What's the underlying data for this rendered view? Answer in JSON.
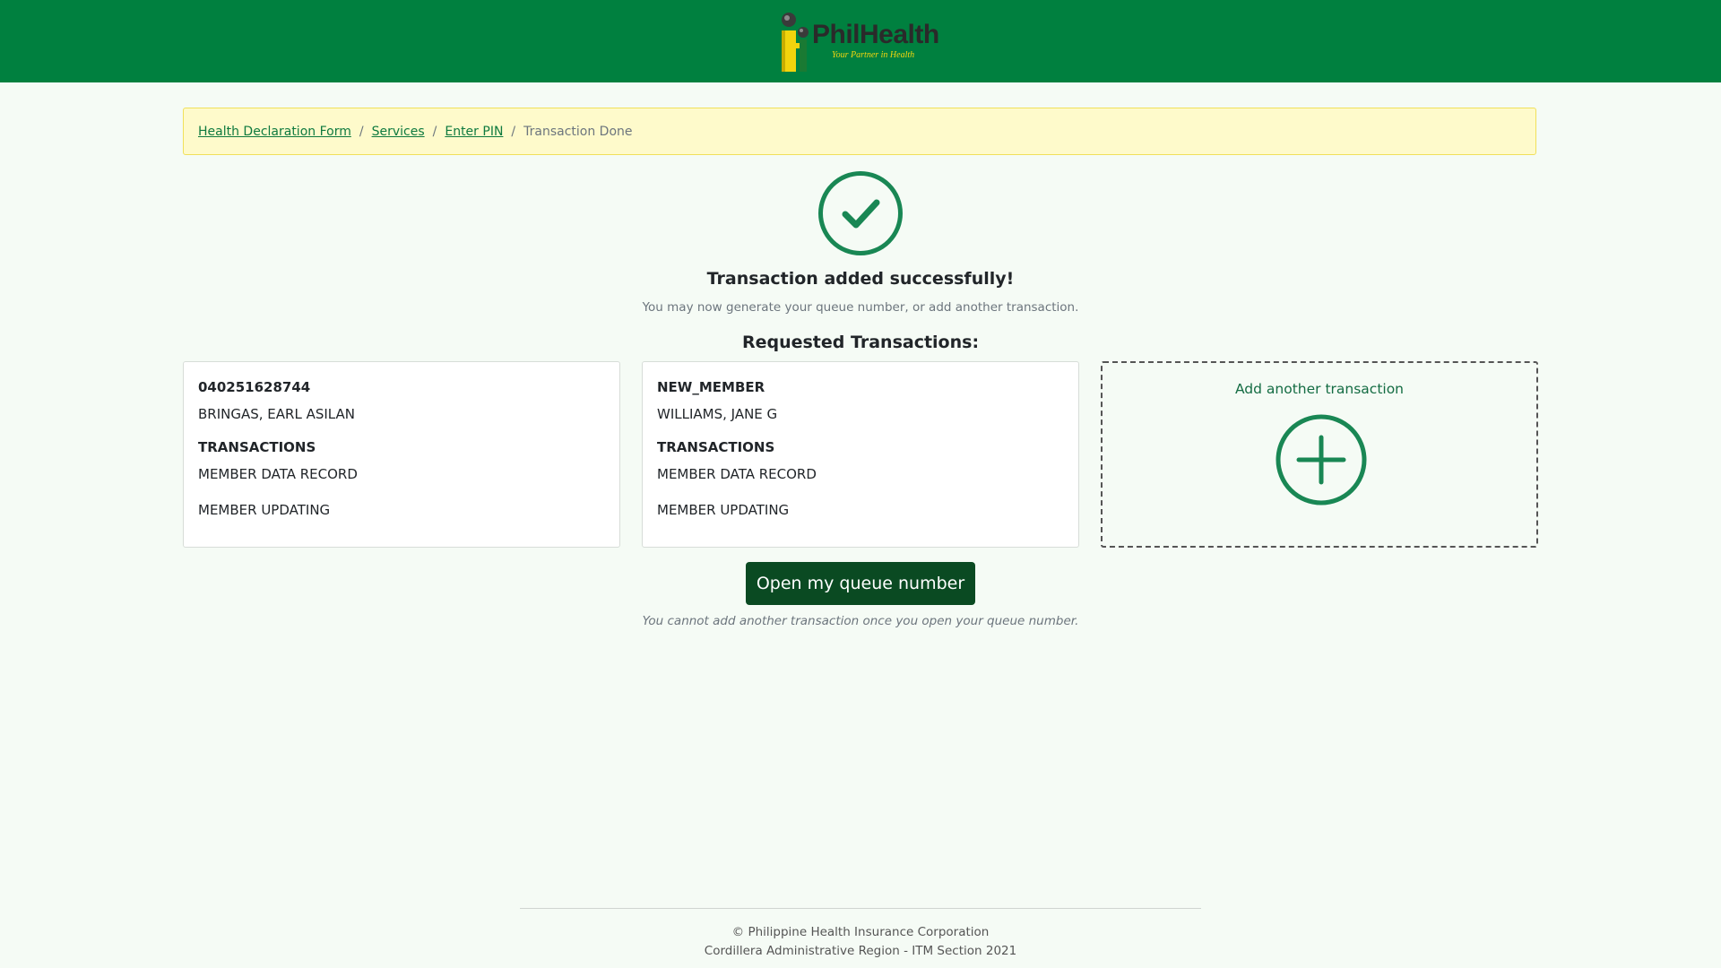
{
  "header": {
    "brand": "PhilHealth",
    "tagline": "Your Partner in Health"
  },
  "breadcrumb": {
    "items": [
      {
        "label": "Health Declaration Form",
        "link": true
      },
      {
        "label": "Services",
        "link": true
      },
      {
        "label": "Enter PIN",
        "link": true
      },
      {
        "label": "Transaction Done",
        "link": false
      }
    ],
    "separator": "/"
  },
  "success": {
    "title": "Transaction added successfully!",
    "subtitle": "You may now generate your queue number, or add another transaction."
  },
  "requested": {
    "heading": "Requested Transactions:",
    "cards": [
      {
        "id": "040251628744",
        "name": "BRINGAS, EARL ASILAN",
        "transactions_heading": "TRANSACTIONS",
        "transactions": [
          "MEMBER DATA RECORD",
          "MEMBER UPDATING"
        ]
      },
      {
        "id": "NEW_MEMBER",
        "name": "WILLIAMS, JANE G",
        "transactions_heading": "TRANSACTIONS",
        "transactions": [
          "MEMBER DATA RECORD",
          "MEMBER UPDATING"
        ]
      }
    ],
    "add_another": "Add another transaction"
  },
  "queue": {
    "button_label": "Open my queue number",
    "note": "You cannot add another transaction once you open your queue number."
  },
  "footer": {
    "line1": "© Philippine Health Insurance Corporation",
    "line2": "Cordillera Administrative Region - ITM Section 2021"
  },
  "icons": {
    "success": "check-circle-icon",
    "add": "plus-circle-icon"
  },
  "colors": {
    "header_green": "#00803f",
    "accent_green": "#198754",
    "button_dark_green": "#0a4a22",
    "breadcrumb_bg": "#fefacb",
    "page_bg": "#f5fbf5"
  }
}
